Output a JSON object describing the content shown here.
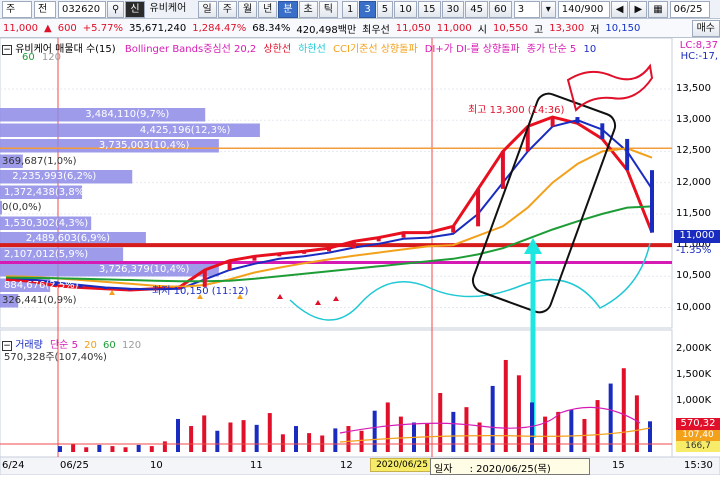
{
  "toolbar": {
    "row1": {
      "mode_label": "주",
      "sel_label": "전",
      "code": "032620",
      "badge": "신",
      "name": "유비케어",
      "periods": [
        "일",
        "주",
        "월",
        "년",
        "분",
        "초",
        "틱"
      ],
      "active_period": "분",
      "intervals": [
        "1",
        "3",
        "5",
        "10",
        "15",
        "30",
        "45",
        "60"
      ],
      "active_interval": "3",
      "interval_value": "3",
      "count": "140/900",
      "date": "06/25"
    },
    "row2": {
      "price": "11,000",
      "change": "600",
      "change_pct": "+5.77%",
      "volume": "35,671,240",
      "vol_ratio": "1,284.47%",
      "strength": "68.34%",
      "amount": "420,498백만",
      "best_seller_label": "최우선",
      "ask": "11,050",
      "bid": "11,000",
      "open_label": "시",
      "open": "10,550",
      "high_label": "고",
      "high": "13,300",
      "low_label": "저",
      "low": "10,150",
      "sell_btn": "매수"
    }
  },
  "legend": {
    "title": "유비케어 매물대 수(15)",
    "bollinger": "Bollinger Bands중심선 20,2",
    "upper": "상한선",
    "lower": "하한선",
    "cci": "CCI기준선 상향돌파",
    "di": "DI+가 DI-를 상향돌파",
    "close_ma": "종가 단순 5",
    "ma_num": "10",
    "small_nums": [
      "60",
      "120"
    ],
    "lc": "LC:8,37",
    "hc": "HC:-17,"
  },
  "price_axis": [
    "13,500",
    "13,000",
    "12,500",
    "12,000",
    "11,500",
    "11,000",
    "10,500",
    "10,000"
  ],
  "current_price_tag": "11,000",
  "current_pct_tag": "-1.35%",
  "volume_profile": [
    {
      "label": "3,484,110(9,7%)",
      "frac": 0.45
    },
    {
      "label": "4,425,196(12,3%)",
      "frac": 0.57
    },
    {
      "label": "3,735,003(10,4%)",
      "frac": 0.48
    },
    {
      "label": "369,687(1,0%)",
      "frac": 0.05
    },
    {
      "label": "2,235,993(6,2%)",
      "frac": 0.29
    },
    {
      "label": "1,372,438(3,8%)",
      "frac": 0.18
    },
    {
      "label": "0(0,0%)",
      "frac": 0.0
    },
    {
      "label": "1,530,302(4,3%)",
      "frac": 0.2
    },
    {
      "label": "2,489,603(6,9%)",
      "frac": 0.32
    },
    {
      "label": "2,107,012(5,9%)",
      "frac": 0.27
    },
    {
      "label": "3,726,379(10,4%)",
      "frac": 0.48
    },
    {
      "label": "884,676(2,5%)",
      "frac": 0.11
    },
    {
      "label": "326,441(0,9%)",
      "frac": 0.04
    }
  ],
  "annotations": {
    "high": "최고 13,300 (14:36)",
    "low": "최저 10,150 (11:12)"
  },
  "volume_panel": {
    "legend": "거래량",
    "legend_ma": "단순 5",
    "ma_nums": [
      "20",
      "60",
      "120"
    ],
    "value": "570,328주(107,40%)",
    "axis": [
      "2,000K",
      "1,500K",
      "1,000K",
      "500K"
    ],
    "tag_value": "570,32",
    "tag_pct": "107,40",
    "tag_min": "166,7"
  },
  "time_axis": [
    "6/24",
    "06/25",
    "10",
    "11",
    "12",
    "13",
    "14",
    "15",
    "15:30"
  ],
  "tooltip": {
    "label": "일자",
    "value": ": 2020/06/25(목)",
    "date_tag": "2020/06/25"
  },
  "colors": {
    "ma5": "#e8101e",
    "ma10": "#1a2cc0",
    "ma20": "#f3a11b",
    "ma60": "#1e9d37",
    "ma120": "#9a9a9a",
    "profile": "#8d8be6",
    "cyan": "#1ec8d4",
    "magenta": "#d61bb5"
  },
  "chart_data": {
    "type": "line",
    "title": "유비케어",
    "series": [
      {
        "name": "5",
        "values": [
          10450,
          10420,
          10350,
          10320,
          10300,
          10280,
          10300,
          10330,
          10600,
          10750,
          10820,
          10860,
          10900,
          10950,
          11060,
          11120,
          11200,
          11200,
          11300,
          11900,
          12500,
          12900,
          13050,
          12950,
          12700,
          12200,
          11200
        ]
      },
      {
        "name": "10",
        "values": [
          10480,
          10450,
          10400,
          10360,
          10320,
          10300,
          10290,
          10300,
          10450,
          10600,
          10700,
          10780,
          10820,
          10880,
          10960,
          11020,
          11100,
          11120,
          11180,
          11500,
          12000,
          12500,
          12900,
          13000,
          12850,
          12500,
          11900
        ]
      },
      {
        "name": "20",
        "values": [
          10500,
          10490,
          10470,
          10440,
          10410,
          10380,
          10350,
          10330,
          10360,
          10450,
          10560,
          10640,
          10710,
          10770,
          10830,
          10880,
          10930,
          10980,
          11000,
          11150,
          11300,
          11600,
          12000,
          12300,
          12500,
          12550,
          12400
        ]
      },
      {
        "name": "60",
        "values": [
          10480,
          10475,
          10470,
          10460,
          10450,
          10440,
          10430,
          10420,
          10420,
          10430,
          10460,
          10500,
          10540,
          10580,
          10620,
          10660,
          10700,
          10740,
          10780,
          10850,
          10950,
          11100,
          11250,
          11380,
          11500,
          11600,
          11620
        ]
      }
    ],
    "ylim": [
      9800,
      13900
    ],
    "volume": [
      0.05,
      0.07,
      0.04,
      0.06,
      0.05,
      0.04,
      0.06,
      0.05,
      0.09,
      0.28,
      0.22,
      0.31,
      0.18,
      0.25,
      0.27,
      0.23,
      0.33,
      0.15,
      0.22,
      0.16,
      0.14,
      0.2,
      0.22,
      0.18,
      0.35,
      0.42,
      0.3,
      0.25,
      0.24,
      0.5,
      0.34,
      0.38,
      0.25,
      0.56,
      0.78,
      0.65,
      0.42,
      0.3,
      0.34,
      0.36,
      0.28,
      0.44,
      0.58,
      0.71,
      0.48,
      0.26
    ]
  }
}
